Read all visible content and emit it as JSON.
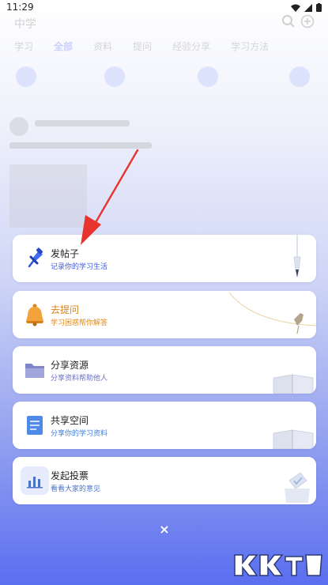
{
  "status_bar": {
    "time": "11:29"
  },
  "background": {
    "grade": "中学",
    "tabs": [
      {
        "label": "学习",
        "active": false
      },
      {
        "label": "全部",
        "active": true
      },
      {
        "label": "资料",
        "active": false
      },
      {
        "label": "提问",
        "active": false
      },
      {
        "label": "经验分享",
        "active": false
      },
      {
        "label": "学习方法",
        "active": false
      }
    ]
  },
  "actions": [
    {
      "title": "发帖子",
      "subtitle": "记录你的学习生活",
      "icon": "pushpin-icon",
      "subtitle_color": "#3f5bd8"
    },
    {
      "title": "去提问",
      "subtitle": "学习困惑帮你解答",
      "icon": "bell-icon",
      "subtitle_color": "#e08a1c"
    },
    {
      "title": "分享资源",
      "subtitle": "分享资料帮助他人",
      "icon": "folder-icon",
      "subtitle_color": "#6a70c8"
    },
    {
      "title": "共享空间",
      "subtitle": "分享你的学习资料",
      "icon": "document-icon",
      "subtitle_color": "#3f7fd8"
    },
    {
      "title": "发起投票",
      "subtitle": "看看大家的意见",
      "icon": "bar-chart-icon",
      "subtitle_color": "#4a72c8"
    }
  ],
  "close_label": "×",
  "colors": {
    "accent": "#3f5bd8",
    "arrow": "#e8332f"
  }
}
